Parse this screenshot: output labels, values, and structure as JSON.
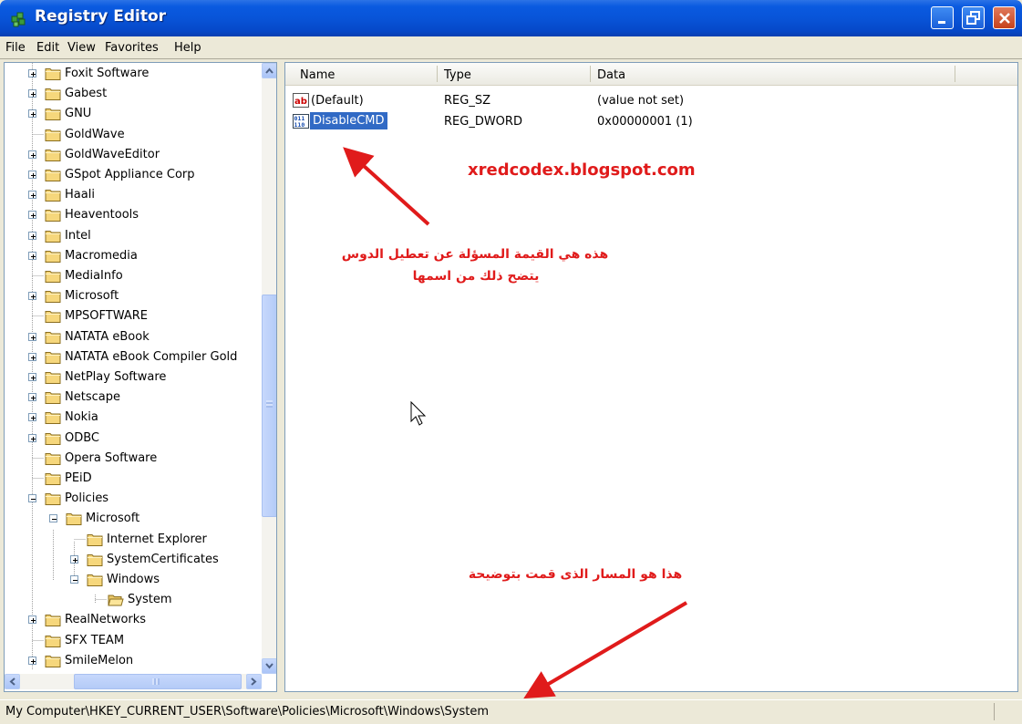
{
  "window": {
    "title": "Registry Editor",
    "icon": "registry-icon"
  },
  "menu": [
    "File",
    "Edit",
    "View",
    "Favorites",
    "Help"
  ],
  "tree": [
    {
      "label": "Foxit Software",
      "expander": "+",
      "level": 0
    },
    {
      "label": "Gabest",
      "expander": "+",
      "level": 0
    },
    {
      "label": "GNU",
      "expander": "+",
      "level": 0
    },
    {
      "label": "GoldWave",
      "expander": "",
      "level": 0
    },
    {
      "label": "GoldWaveEditor",
      "expander": "+",
      "level": 0
    },
    {
      "label": "GSpot Appliance Corp",
      "expander": "+",
      "level": 0
    },
    {
      "label": "Haali",
      "expander": "+",
      "level": 0
    },
    {
      "label": "Heaventools",
      "expander": "+",
      "level": 0
    },
    {
      "label": "Intel",
      "expander": "+",
      "level": 0
    },
    {
      "label": "Macromedia",
      "expander": "+",
      "level": 0
    },
    {
      "label": "MediaInfo",
      "expander": "",
      "level": 0
    },
    {
      "label": "Microsoft",
      "expander": "+",
      "level": 0
    },
    {
      "label": "MPSOFTWARE",
      "expander": "",
      "level": 0
    },
    {
      "label": "NATATA eBook",
      "expander": "+",
      "level": 0
    },
    {
      "label": "NATATA eBook Compiler Gold",
      "expander": "+",
      "level": 0
    },
    {
      "label": "NetPlay Software",
      "expander": "+",
      "level": 0
    },
    {
      "label": "Netscape",
      "expander": "+",
      "level": 0
    },
    {
      "label": "Nokia",
      "expander": "+",
      "level": 0
    },
    {
      "label": "ODBC",
      "expander": "+",
      "level": 0
    },
    {
      "label": "Opera Software",
      "expander": "",
      "level": 0
    },
    {
      "label": "PEiD",
      "expander": "",
      "level": 0
    },
    {
      "label": "Policies",
      "expander": "-",
      "level": 0
    },
    {
      "label": "Microsoft",
      "expander": "-",
      "level": 1
    },
    {
      "label": "Internet Explorer",
      "expander": "",
      "level": 2
    },
    {
      "label": "SystemCertificates",
      "expander": "+",
      "level": 2
    },
    {
      "label": "Windows",
      "expander": "-",
      "level": 2
    },
    {
      "label": "System",
      "expander": "",
      "level": 3
    },
    {
      "label": "RealNetworks",
      "expander": "+",
      "level": 0
    },
    {
      "label": "SFX TEAM",
      "expander": "",
      "level": 0
    },
    {
      "label": "SmileMelon",
      "expander": "+",
      "level": 0
    }
  ],
  "list": {
    "columns": [
      "Name",
      "Type",
      "Data"
    ],
    "rows": [
      {
        "name": "(Default)",
        "type": "REG_SZ",
        "data": "(value not set)",
        "icon": "string-value-icon"
      },
      {
        "name": "DisableCMD",
        "type": "REG_DWORD",
        "data": "0x00000001 (1)",
        "icon": "binary-value-icon",
        "selected": true
      }
    ]
  },
  "annotations": {
    "url": "xredcodex.blogspot.com",
    "value_note_line1": "هذه هي القيمة المسؤلة عن تعطيل الدوس",
    "value_note_line2": "يتضح ذلك من اسمها",
    "path_note": "هذا هو المسار الذى قمت بتوضيحة",
    "color": "#e01b1b"
  },
  "status": {
    "path": "My Computer\\HKEY_CURRENT_USER\\Software\\Policies\\Microsoft\\Windows\\System"
  }
}
